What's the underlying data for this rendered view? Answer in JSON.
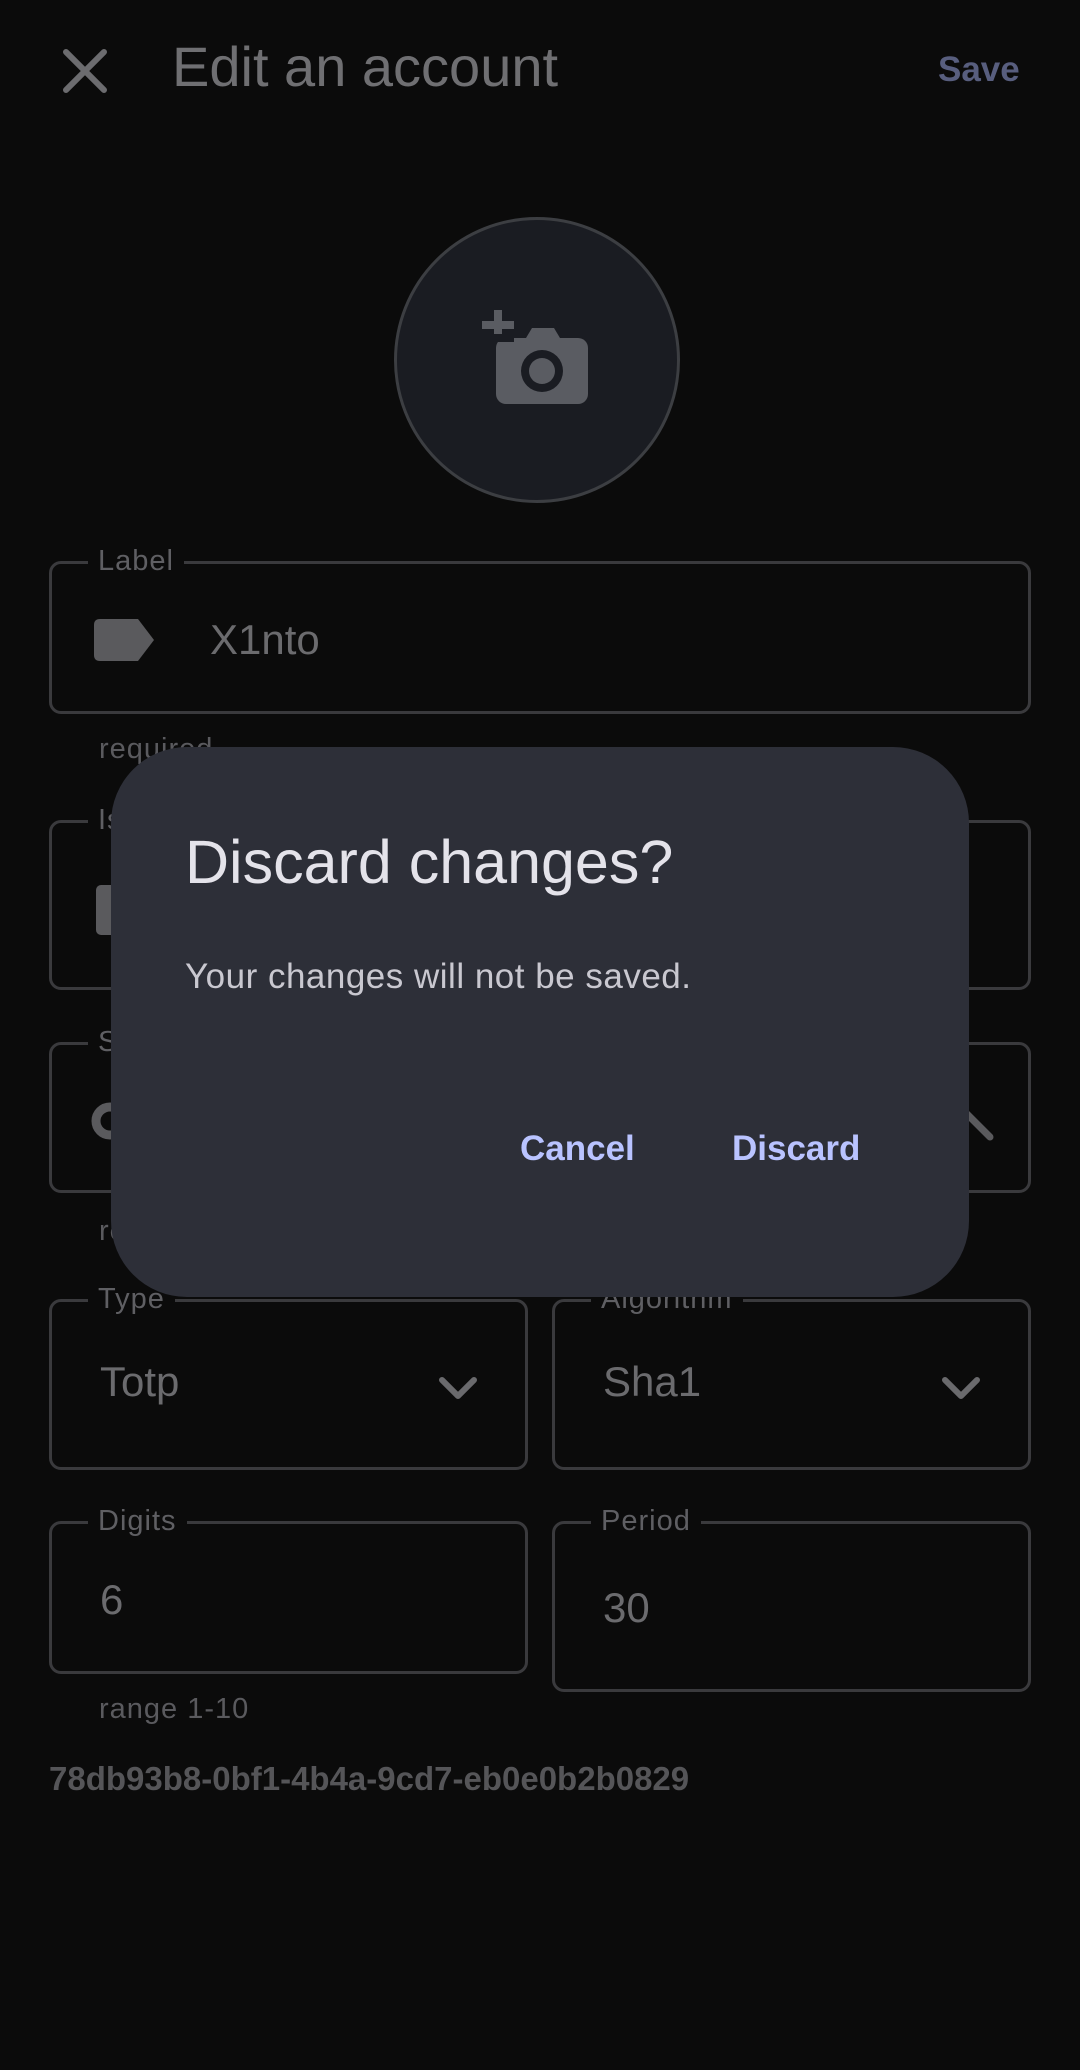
{
  "app_bar": {
    "title": "Edit an account",
    "save_label": "Save",
    "close_icon": "close-icon"
  },
  "avatar": {
    "icon": "add-a-photo-icon"
  },
  "form": {
    "label": {
      "label": "Label",
      "value": "X1nto",
      "helper": "required",
      "icon": "label-tag-icon"
    },
    "issuer": {
      "label": "Is",
      "icon": "business-icon"
    },
    "secret": {
      "label": "S",
      "helper": "re",
      "icon": "key-icon",
      "trailing_icon": "visibility-off-icon"
    },
    "type": {
      "label": "Type",
      "value": "Totp"
    },
    "algorithm": {
      "label": "Algorithm",
      "value": "Sha1"
    },
    "digits": {
      "label": "Digits",
      "value": "6",
      "helper": "range 1-10"
    },
    "period": {
      "label": "Period",
      "value": "30"
    },
    "uuid": "78db93b8-0bf1-4b4a-9cd7-eb0e0b2b0829"
  },
  "dialog": {
    "title": "Discard changes?",
    "message": "Your changes will not be saved.",
    "cancel_label": "Cancel",
    "discard_label": "Discard"
  },
  "colors": {
    "background": "#0b0b0b",
    "dialog_surface": "#2d2f38",
    "dialog_button": "#b9c3ff"
  }
}
